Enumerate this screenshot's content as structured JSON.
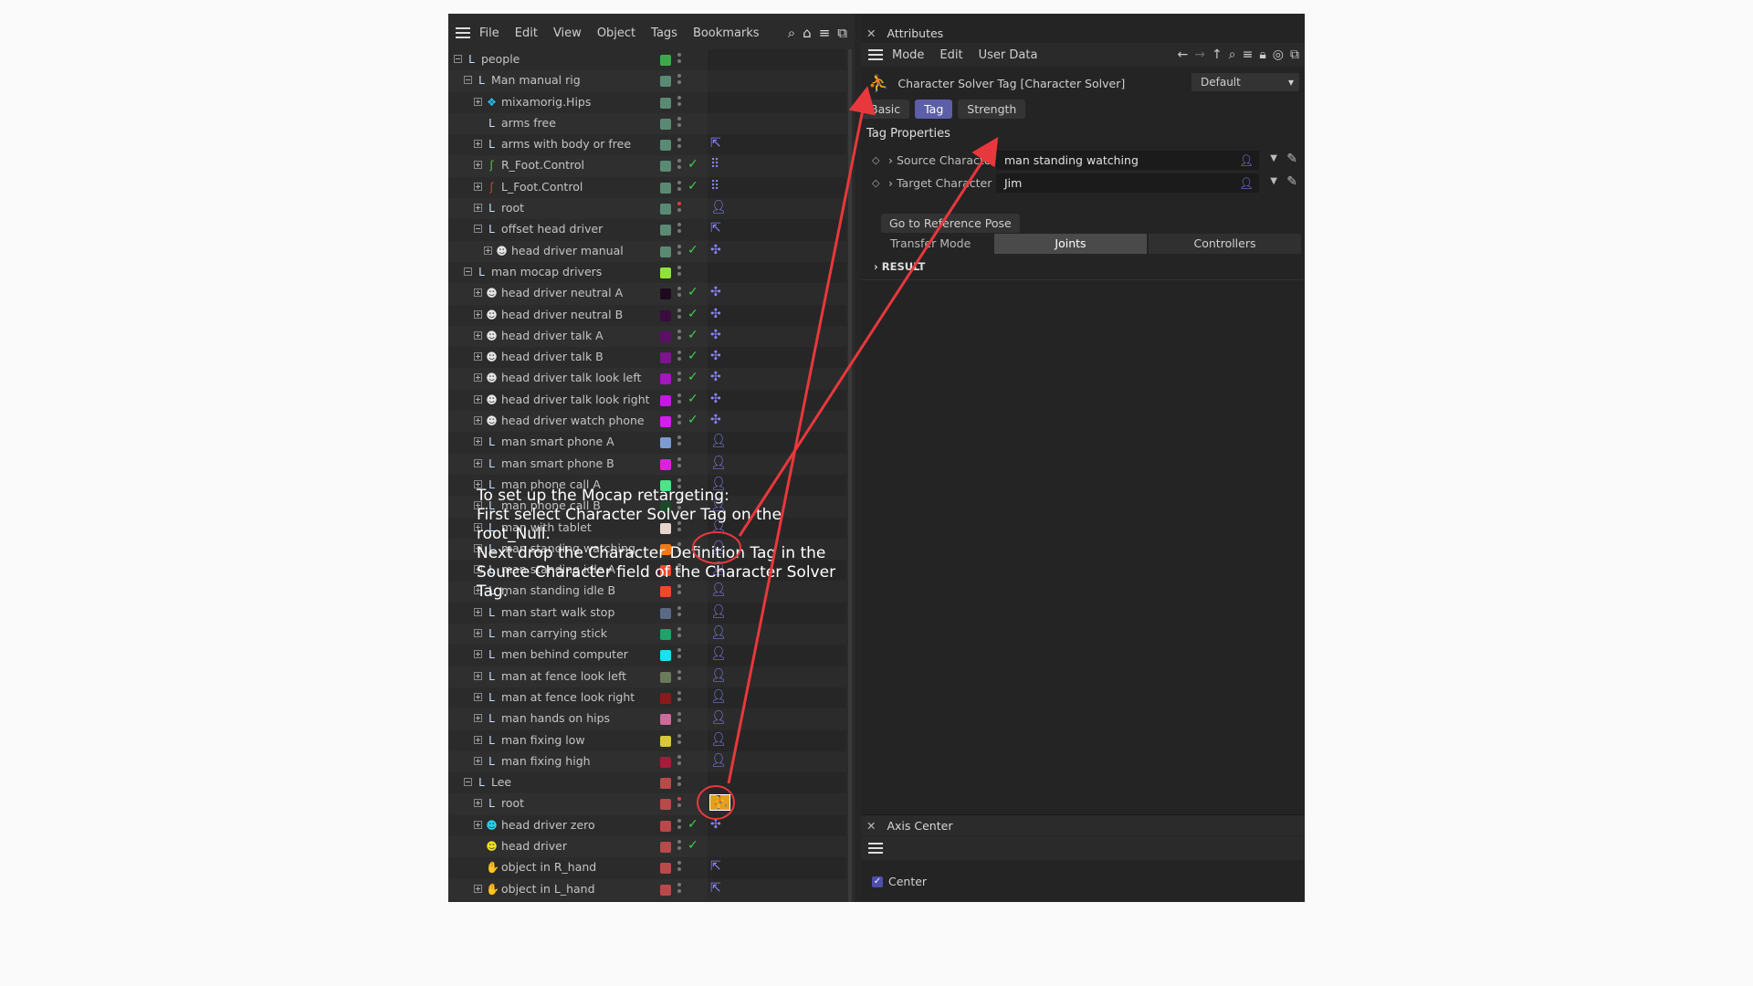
{
  "object_manager": {
    "menu": [
      "File",
      "Edit",
      "View",
      "Object",
      "Tags",
      "Bookmarks"
    ],
    "tool_icons": [
      "search-icon",
      "home-icon",
      "filter-icon",
      "new-window-icon"
    ],
    "rows": [
      {
        "name": "people",
        "indent": 0,
        "expander": "minus",
        "icon": "null-icon",
        "color": "#3fa84c",
        "dots": "grey",
        "check": false,
        "tag": ""
      },
      {
        "name": "Man manual rig",
        "indent": 1,
        "expander": "minus",
        "icon": "null-icon",
        "color": "#5a8a74",
        "dots": "grey",
        "check": false,
        "tag": ""
      },
      {
        "name": "mixamorig.Hips",
        "indent": 2,
        "expander": "plus",
        "icon": "joint-icon",
        "color": "#5a8a74",
        "dots": "grey",
        "check": false,
        "tag": ""
      },
      {
        "name": "arms free",
        "indent": 2,
        "expander": "",
        "icon": "null-icon",
        "color": "#5a8a74",
        "dots": "grey",
        "check": false,
        "tag": ""
      },
      {
        "name": "arms with body or free",
        "indent": 2,
        "expander": "plus",
        "icon": "null-icon",
        "color": "#5a8a74",
        "dots": "grey",
        "check": false,
        "tag": "constraint-tag-icon"
      },
      {
        "name": "R_Foot.Control",
        "indent": 2,
        "expander": "plus",
        "icon": "foot-green-icon",
        "color": "#5a8a74",
        "dots": "grey",
        "check": true,
        "tag": "ik-tag-icon"
      },
      {
        "name": "L_Foot.Control",
        "indent": 2,
        "expander": "plus",
        "icon": "foot-red-icon",
        "color": "#5a8a74",
        "dots": "grey",
        "check": true,
        "tag": "ik-tag-icon"
      },
      {
        "name": "root",
        "indent": 2,
        "expander": "plus",
        "icon": "null-icon",
        "color": "#5a8a74",
        "dots": "red",
        "check": false,
        "tag": "character-definition-tag-icon"
      },
      {
        "name": "offset head driver",
        "indent": 2,
        "expander": "minus",
        "icon": "null-icon",
        "color": "#5a8a74",
        "dots": "grey",
        "check": false,
        "tag": "constraint-tag-icon"
      },
      {
        "name": "head driver manual",
        "indent": 3,
        "expander": "plus",
        "icon": "head-icon",
        "color": "#5a8a74",
        "dots": "grey",
        "check": true,
        "tag": "pose-morph-tag-icon"
      },
      {
        "name": "man mocap drivers",
        "indent": 1,
        "expander": "minus",
        "icon": "null-icon",
        "color": "#8fe33a",
        "dots": "grey",
        "check": false,
        "tag": ""
      },
      {
        "name": "head driver  neutral A",
        "indent": 2,
        "expander": "plus",
        "icon": "head-icon",
        "color": "#1d0a1e",
        "dots": "grey",
        "check": true,
        "tag": "pose-morph-tag-icon"
      },
      {
        "name": "head driver  neutral B",
        "indent": 2,
        "expander": "plus",
        "icon": "head-icon",
        "color": "#3a0c40",
        "dots": "grey",
        "check": true,
        "tag": "pose-morph-tag-icon"
      },
      {
        "name": "head driver  talk A",
        "indent": 2,
        "expander": "plus",
        "icon": "head-icon",
        "color": "#5b1066",
        "dots": "grey",
        "check": true,
        "tag": "pose-morph-tag-icon"
      },
      {
        "name": "head driver  talk B",
        "indent": 2,
        "expander": "plus",
        "icon": "head-icon",
        "color": "#7d148e",
        "dots": "grey",
        "check": true,
        "tag": "pose-morph-tag-icon"
      },
      {
        "name": "head driver  talk look left",
        "indent": 2,
        "expander": "plus",
        "icon": "head-icon",
        "color": "#a417bd",
        "dots": "grey",
        "check": true,
        "tag": "pose-morph-tag-icon"
      },
      {
        "name": "head driver  talk look right",
        "indent": 2,
        "expander": "plus",
        "icon": "head-icon",
        "color": "#c21ae0",
        "dots": "grey",
        "check": true,
        "tag": "pose-morph-tag-icon"
      },
      {
        "name": "head driver  watch phone",
        "indent": 2,
        "expander": "plus",
        "icon": "head-icon",
        "color": "#d61cf0",
        "dots": "grey",
        "check": true,
        "tag": "pose-morph-tag-icon"
      },
      {
        "name": "man smart phone A",
        "indent": 2,
        "expander": "plus",
        "icon": "null-icon",
        "color": "#7b9bd1",
        "dots": "grey",
        "check": false,
        "tag": "character-definition-tag-icon"
      },
      {
        "name": "man smart phone B",
        "indent": 2,
        "expander": "plus",
        "icon": "null-icon",
        "color": "#e020d8",
        "dots": "grey",
        "check": false,
        "tag": "character-definition-tag-icon"
      },
      {
        "name": "man phone call A",
        "indent": 2,
        "expander": "plus",
        "icon": "null-icon",
        "color": "#4ce38a",
        "dots": "grey",
        "check": false,
        "tag": "character-definition-tag-icon"
      },
      {
        "name": "man phone call B",
        "indent": 2,
        "expander": "plus",
        "icon": "null-icon",
        "color": "#1a4a2a",
        "dots": "grey",
        "check": false,
        "tag": "character-definition-tag-icon"
      },
      {
        "name": "man with tablet",
        "indent": 2,
        "expander": "plus",
        "icon": "null-icon",
        "color": "#e8d4cc",
        "dots": "grey",
        "check": false,
        "tag": "character-definition-tag-icon"
      },
      {
        "name": "man standing watching",
        "indent": 2,
        "expander": "plus",
        "icon": "null-icon",
        "color": "#f07a18",
        "dots": "grey",
        "check": false,
        "tag": "character-definition-tag-icon"
      },
      {
        "name": "man standing idle A",
        "indent": 2,
        "expander": "plus",
        "icon": "null-icon",
        "color": "#ee4a2a",
        "dots": "grey",
        "check": false,
        "tag": "character-definition-tag-icon"
      },
      {
        "name": "man standing idle B",
        "indent": 2,
        "expander": "plus",
        "icon": "null-icon",
        "color": "#ee4a2a",
        "dots": "grey",
        "check": false,
        "tag": "character-definition-tag-icon"
      },
      {
        "name": "man start walk stop",
        "indent": 2,
        "expander": "plus",
        "icon": "null-icon",
        "color": "#5a6a84",
        "dots": "grey",
        "check": false,
        "tag": "character-definition-tag-icon"
      },
      {
        "name": "man carrying stick",
        "indent": 2,
        "expander": "plus",
        "icon": "null-icon",
        "color": "#1ea36a",
        "dots": "grey",
        "check": false,
        "tag": "character-definition-tag-icon"
      },
      {
        "name": "men behind computer",
        "indent": 2,
        "expander": "plus",
        "icon": "null-icon",
        "color": "#1ae0f0",
        "dots": "grey",
        "check": false,
        "tag": "character-definition-tag-icon"
      },
      {
        "name": "man at fence look left",
        "indent": 2,
        "expander": "plus",
        "icon": "null-icon",
        "color": "#6a7a5a",
        "dots": "grey",
        "check": false,
        "tag": "character-definition-tag-icon"
      },
      {
        "name": "man at fence look right",
        "indent": 2,
        "expander": "plus",
        "icon": "null-icon",
        "color": "#8a1a1a",
        "dots": "grey",
        "check": false,
        "tag": "character-definition-tag-icon"
      },
      {
        "name": "man hands on hips",
        "indent": 2,
        "expander": "plus",
        "icon": "null-icon",
        "color": "#d06a9a",
        "dots": "grey",
        "check": false,
        "tag": "character-definition-tag-icon"
      },
      {
        "name": "man fixing low",
        "indent": 2,
        "expander": "plus",
        "icon": "null-icon",
        "color": "#d8c83a",
        "dots": "grey",
        "check": false,
        "tag": "character-definition-tag-icon"
      },
      {
        "name": "man fixing high",
        "indent": 2,
        "expander": "plus",
        "icon": "null-icon",
        "color": "#a81a3a",
        "dots": "grey",
        "check": false,
        "tag": "character-definition-tag-icon"
      },
      {
        "name": "Lee",
        "indent": 1,
        "expander": "minus",
        "icon": "null-icon",
        "color": "#b84a4a",
        "dots": "grey",
        "check": false,
        "tag": ""
      },
      {
        "name": "root",
        "indent": 2,
        "expander": "plus",
        "icon": "null-icon",
        "color": "#b84a4a",
        "dots": "red",
        "check": false,
        "tag": "character-solver-tag-icon"
      },
      {
        "name": "head driver zero",
        "indent": 2,
        "expander": "plus",
        "icon": "head-cyan-icon",
        "color": "#b84a4a",
        "dots": "grey",
        "check": true,
        "tag": "pose-morph-tag-icon"
      },
      {
        "name": "head driver",
        "indent": 2,
        "expander": "",
        "icon": "head-yellow-icon",
        "color": "#b84a4a",
        "dots": "grey",
        "check": true,
        "tag": ""
      },
      {
        "name": "object in R_hand",
        "indent": 2,
        "expander": "",
        "icon": "hand-green-icon",
        "color": "#b84a4a",
        "dots": "grey",
        "check": false,
        "tag": "constraint-tag-icon"
      },
      {
        "name": "object in L_hand",
        "indent": 2,
        "expander": "plus",
        "icon": "hand-red-icon",
        "color": "#b84a4a",
        "dots": "grey",
        "check": false,
        "tag": "constraint-tag-icon"
      }
    ]
  },
  "attributes": {
    "title": "Attributes",
    "menu": [
      "Mode",
      "Edit",
      "User Data"
    ],
    "tag_title": "Character Solver Tag [Character Solver]",
    "preset": "Default",
    "tabs": [
      "Basic",
      "Tag",
      "Strength"
    ],
    "active_tab": "Tag",
    "section": "Tag Properties",
    "source_label": "Source Character",
    "source_value": "man standing watching",
    "target_label": "Target Character",
    "target_value": "Jim",
    "reference_button": "Go to Reference Pose",
    "transfer_label": "Transfer Mode",
    "transfer_options": [
      "Joints",
      "Controllers"
    ],
    "transfer_selected": "Joints",
    "result_label": "RESULT"
  },
  "axis_center": {
    "title": "Axis Center",
    "center_label": "Center",
    "center_checked": true
  },
  "annotation": {
    "text": "To set up the Mocap retargeting:\nFirst select Character Solver Tag on  the root_Null.\nNext drop the Character Definition Tag in the\nSource Character field of the Character Solver Tag.",
    "arrow_color": "#e8383d"
  }
}
